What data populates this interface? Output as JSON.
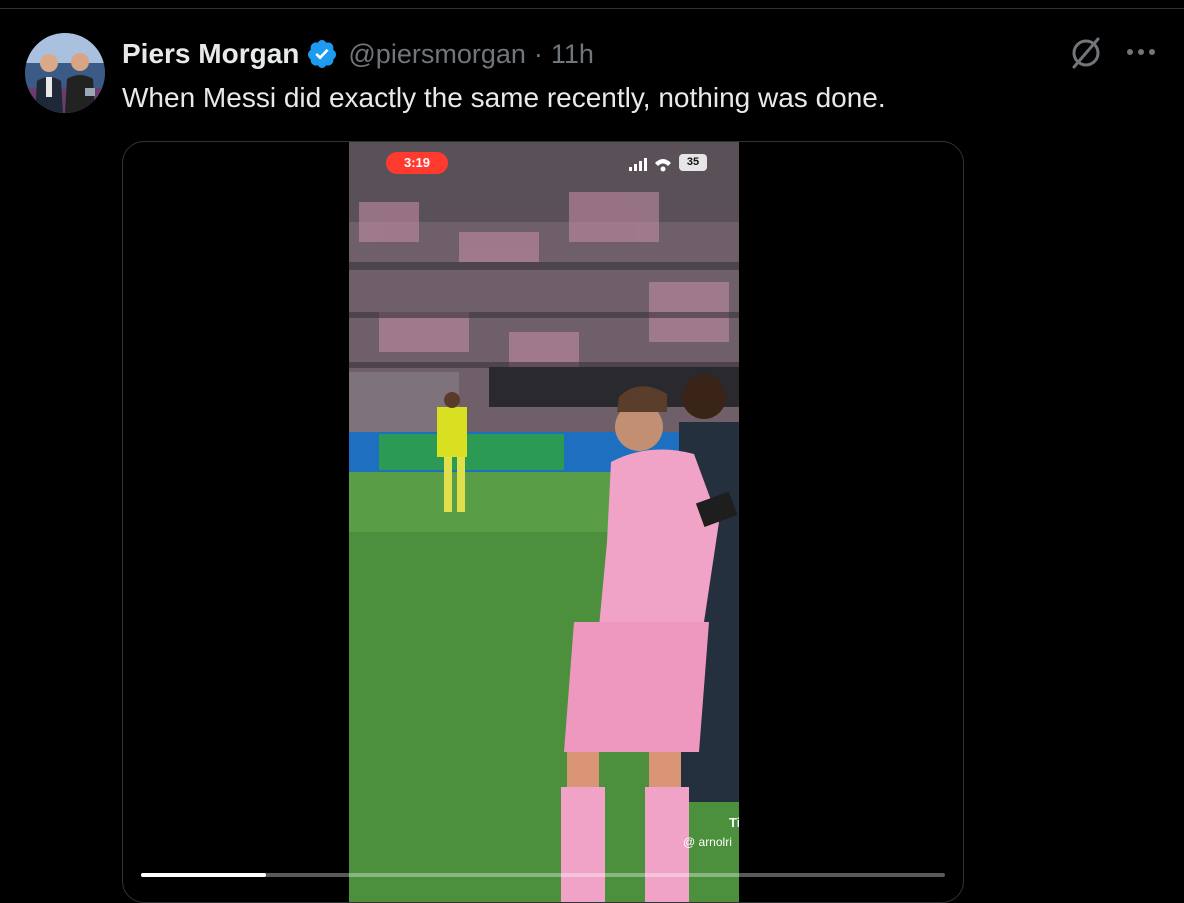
{
  "tweet": {
    "author_name": "Piers Morgan",
    "handle": "@piersmorgan",
    "separator": "·",
    "timestamp": "11h",
    "text": "When Messi did exactly the same recently, nothing was done.",
    "verified_icon": "verified-badge-icon",
    "grok_icon": "grok-slash-icon",
    "more_icon": "more-dots-icon"
  },
  "media": {
    "video_status_time": "3:19",
    "battery_level": "35",
    "watermark_app": "Tik",
    "watermark_user": "@ arnolri",
    "progress_fraction": 0.155
  },
  "colors": {
    "background": "#000000",
    "text_primary": "#e7e9ea",
    "text_secondary": "#71767b",
    "verified_blue": "#1d9bf0",
    "jersey_pink": "#f0a3c6",
    "pitch_green": "#4c8f3c"
  }
}
